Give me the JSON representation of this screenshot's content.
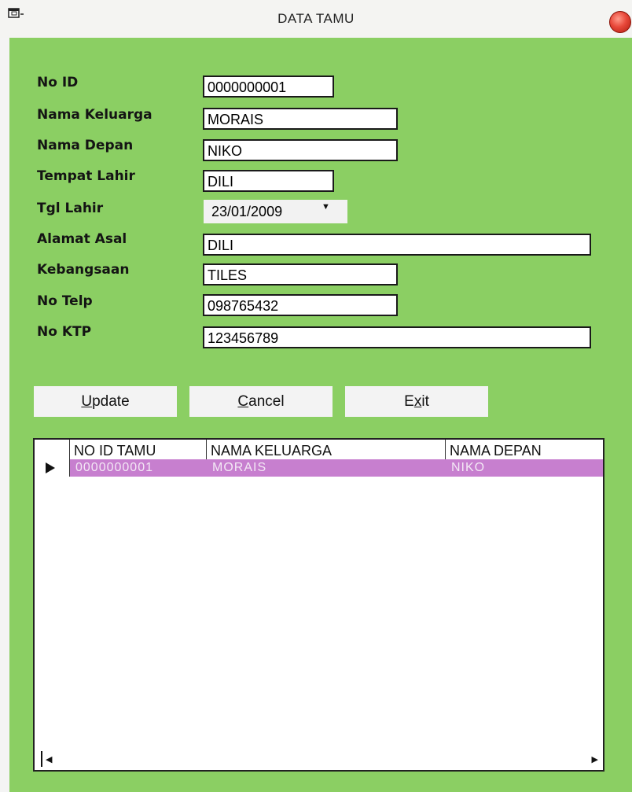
{
  "window": {
    "title": "DATA TAMU"
  },
  "form": {
    "no_id": {
      "label": "No ID",
      "value": "0000000001"
    },
    "nama_keluarga": {
      "label": "Nama Keluarga",
      "value": "MORAIS"
    },
    "nama_depan": {
      "label": "Nama Depan",
      "value": "NIKO"
    },
    "tempat_lahir": {
      "label": "Tempat Lahir",
      "value": "DILI"
    },
    "tgl_lahir": {
      "label": "Tgl Lahir",
      "value": "23/01/2009"
    },
    "alamat_asal": {
      "label": "Alamat Asal",
      "value": "DILI"
    },
    "kebangsaan": {
      "label": "Kebangsaan",
      "value": "TILES"
    },
    "no_telp": {
      "label": "No Telp",
      "value": "098765432"
    },
    "no_ktp": {
      "label": "No KTP",
      "value": "123456789"
    }
  },
  "buttons": {
    "update": {
      "hotkey": "U",
      "rest": "pdate"
    },
    "cancel": {
      "hotkey": "C",
      "rest": "ancel"
    },
    "exit": {
      "pre": "E",
      "hotkey": "x",
      "rest": "it"
    }
  },
  "grid": {
    "columns": [
      "NO ID TAMU",
      "NAMA KELUARGA",
      "NAMA DEPAN"
    ],
    "rows": [
      [
        "0000000001",
        "MORAIS",
        "NIKO"
      ]
    ]
  },
  "colors": {
    "form_background": "#8bcf63",
    "selected_row": "#c77fcf"
  },
  "icons": {
    "window": "window-icon",
    "close": "close-icon",
    "dropdown": "chevron-down-icon",
    "row_indicator": "row-pointer-icon",
    "scroll_left": "scroll-left-icon",
    "scroll_right": "scroll-right-icon"
  }
}
